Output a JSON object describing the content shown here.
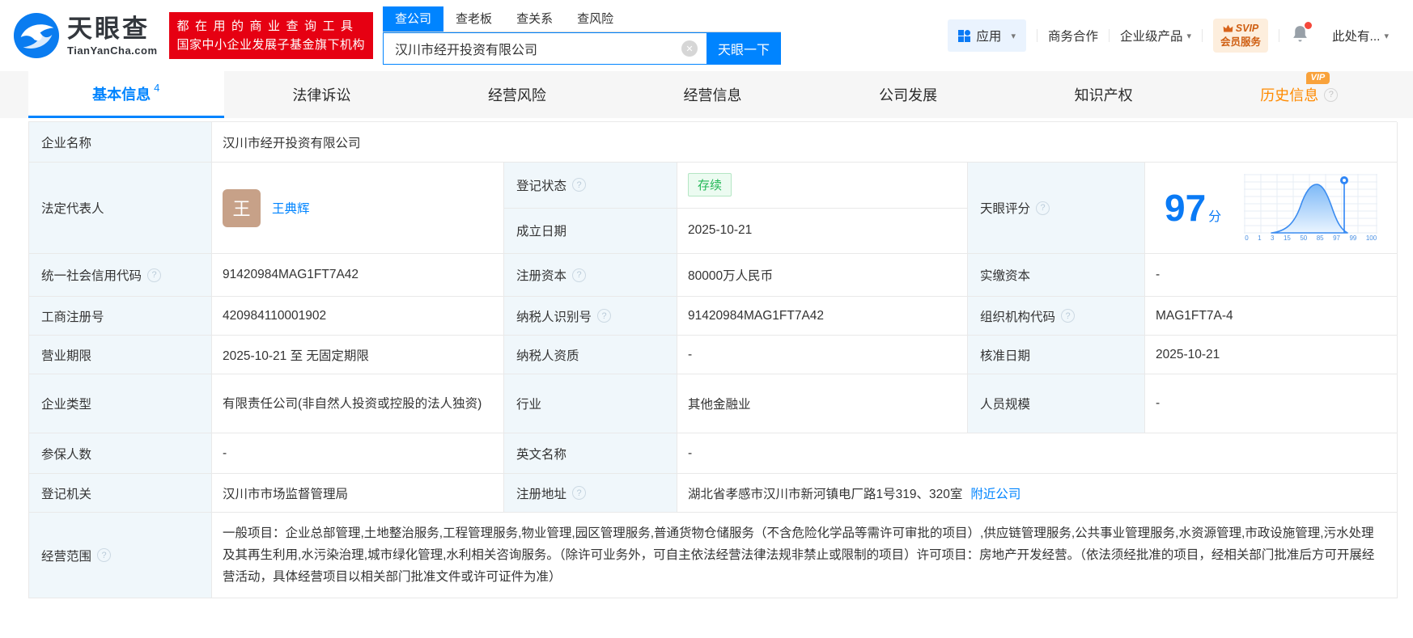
{
  "header": {
    "brand": {
      "name": "天眼查",
      "domain": "TianYanCha.com"
    },
    "slogan": {
      "line1": "都在用的商业查询工具",
      "line2": "国家中小企业发展子基金旗下机构"
    },
    "search": {
      "tabs": [
        "查公司",
        "查老板",
        "查关系",
        "查风险"
      ],
      "value": "汉川市经开投资有限公司",
      "button": "天眼一下"
    },
    "nav": {
      "apps": "应用",
      "cooperation": "商务合作",
      "enterprise": "企业级产品",
      "svip_top": "SVIP",
      "svip_bottom": "会员服务",
      "account": "此处有..."
    }
  },
  "page_tabs": {
    "basic": {
      "label": "基本信息",
      "count": "4"
    },
    "legal": "法律诉讼",
    "risk": "经营风险",
    "operating": "经营信息",
    "development": "公司发展",
    "ip": "知识产权",
    "history": {
      "label": "历史信息",
      "badge": "VIP"
    }
  },
  "info": {
    "company_name": {
      "label": "企业名称",
      "value": "汉川市经开投资有限公司"
    },
    "legal_rep": {
      "label": "法定代表人",
      "avatar": "王",
      "name": "王典辉"
    },
    "reg_status": {
      "label": "登记状态",
      "value": "存续"
    },
    "establish_date": {
      "label": "成立日期",
      "value": "2025-10-21"
    },
    "tyc_score": {
      "label": "天眼评分",
      "score": "97",
      "unit": "分"
    },
    "credit_code": {
      "label": "统一社会信用代码",
      "value": "91420984MAG1FT7A42"
    },
    "reg_capital": {
      "label": "注册资本",
      "value": "80000万人民币"
    },
    "paid_capital": {
      "label": "实缴资本",
      "value": "-"
    },
    "reg_number": {
      "label": "工商注册号",
      "value": "420984110001902"
    },
    "taxpayer_id": {
      "label": "纳税人识别号",
      "value": "91420984MAG1FT7A42"
    },
    "org_code": {
      "label": "组织机构代码",
      "value": "MAG1FT7A-4"
    },
    "business_term": {
      "label": "营业期限",
      "value": "2025-10-21 至 无固定期限"
    },
    "taxpayer_quality": {
      "label": "纳税人资质",
      "value": "-"
    },
    "approval_date": {
      "label": "核准日期",
      "value": "2025-10-21"
    },
    "company_type": {
      "label": "企业类型",
      "value": "有限责任公司(非自然人投资或控股的法人独资)"
    },
    "industry": {
      "label": "行业",
      "value": "其他金融业"
    },
    "staff_size": {
      "label": "人员规模",
      "value": "-"
    },
    "insured_count": {
      "label": "参保人数",
      "value": "-"
    },
    "english_name": {
      "label": "英文名称",
      "value": "-"
    },
    "reg_authority": {
      "label": "登记机关",
      "value": "汉川市市场监督管理局"
    },
    "reg_address": {
      "label": "注册地址",
      "value": "湖北省孝感市汉川市新河镇电厂路1号319、320室",
      "link": "附近公司"
    },
    "business_scope": {
      "label": "经营范围",
      "value": "一般项目：企业总部管理,土地整治服务,工程管理服务,物业管理,园区管理服务,普通货物仓储服务（不含危险化学品等需许可审批的项目）,供应链管理服务,公共事业管理服务,水资源管理,市政设施管理,污水处理及其再生利用,水污染治理,城市绿化管理,水利相关咨询服务。（除许可业务外，可自主依法经营法律法规非禁止或限制的项目）许可项目：房地产开发经营。（依法须经批准的项目，经相关部门批准后方可开展经营活动，具体经营项目以相关部门批准文件或许可证件为准）"
    }
  },
  "chart_data": {
    "type": "area",
    "title": "天眼评分分布曲线",
    "xticks": [
      "0",
      "1",
      "3",
      "15",
      "50",
      "85",
      "97",
      "99",
      "100"
    ],
    "marker_value": 97,
    "score": 97,
    "legend_position": "none",
    "grid": true
  },
  "colors": {
    "brand_blue": "#0084ff",
    "brand_red": "#e60012",
    "status_green": "#23b857",
    "history_orange": "#ff8a00",
    "svip_orange": "#cf5f13",
    "label_cell_bg": "#f0f7fb",
    "avatar_bg": "#c7a188"
  }
}
